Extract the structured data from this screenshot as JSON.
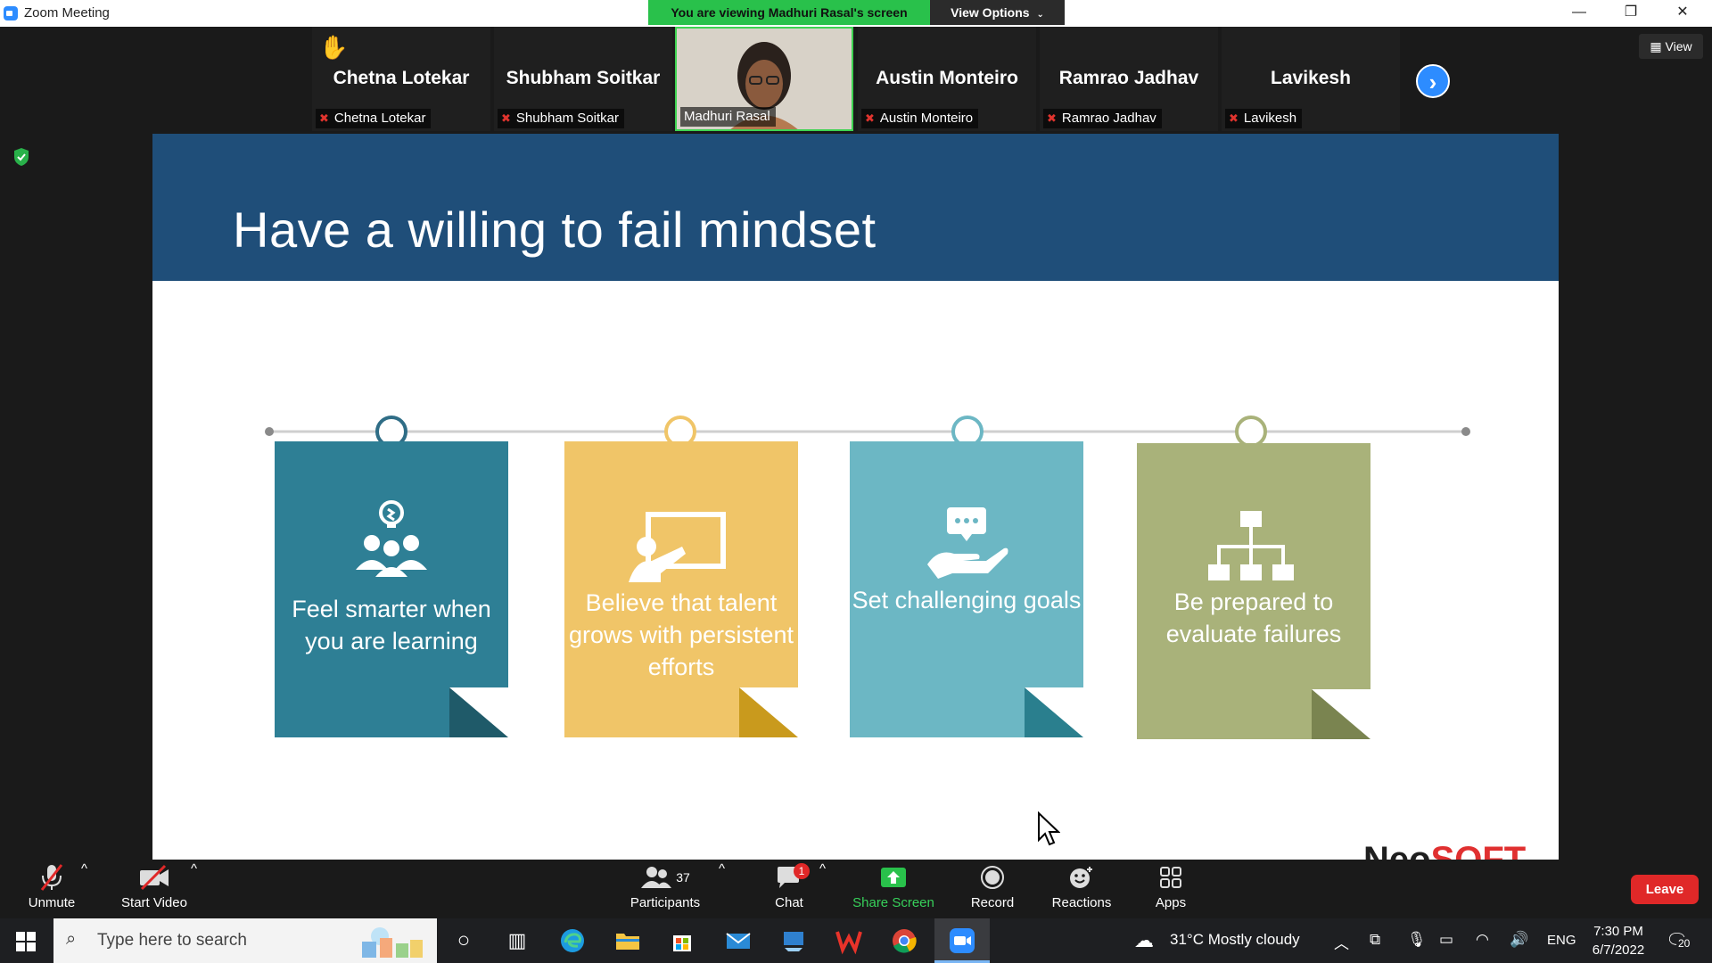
{
  "window": {
    "title": "Zoom Meeting"
  },
  "share_banner": "You are viewing Madhuri Rasal's screen",
  "view_options": "View Options",
  "view_button": "View",
  "participants_strip": [
    {
      "big": "Chetna Lotekar",
      "label": "Chetna Lotekar",
      "hand": "✋",
      "muted": true
    },
    {
      "big": "Shubham Soitkar",
      "label": "Shubham Soitkar",
      "muted": true
    },
    {
      "big": "",
      "label": "Madhuri Rasal",
      "video": true,
      "muted": false
    },
    {
      "big": "Austin Monteiro",
      "label": "Austin Monteiro",
      "muted": true
    },
    {
      "big": "Ramrao Jadhav",
      "label": "Ramrao Jadhav",
      "muted": true
    },
    {
      "big": "Lavikesh",
      "label": "Lavikesh",
      "muted": true
    }
  ],
  "slide": {
    "title": "Have a willing to fail mindset",
    "cards": [
      {
        "text": "Feel smarter when you are learning",
        "color": "#2e7f95",
        "fold": "#1f5a69",
        "icon": "team-idea-icon"
      },
      {
        "text": "Believe that talent grows with persistent efforts",
        "color": "#f0c568",
        "fold": "#c99a1d",
        "icon": "presentation-board-icon"
      },
      {
        "text": "Set challenging goals",
        "color": "#6cb7c4",
        "fold": "#2a7f8e",
        "icon": "hand-chat-icon"
      },
      {
        "text": "Be prepared to evaluate failures",
        "color": "#a9b27a",
        "fold": "#7a8450",
        "icon": "org-chart-icon"
      }
    ],
    "timeline_circle_colors": [
      "#2f6d86",
      "#f0c568",
      "#6cb7c4",
      "#a9b27a"
    ],
    "logo": {
      "part1": "Neo",
      "part2": "SOFT"
    }
  },
  "toolbar": {
    "unmute": "Unmute",
    "start_video": "Start Video",
    "participants": "Participants",
    "participants_count": "37",
    "chat": "Chat",
    "chat_badge": "1",
    "share_screen": "Share Screen",
    "record": "Record",
    "reactions": "Reactions",
    "apps": "Apps",
    "leave": "Leave"
  },
  "taskbar": {
    "search_placeholder": "Type here to search",
    "weather": "31°C  Mostly cloudy",
    "language": "ENG",
    "time": "7:30 PM",
    "date": "6/7/2022",
    "notifications": "20"
  }
}
